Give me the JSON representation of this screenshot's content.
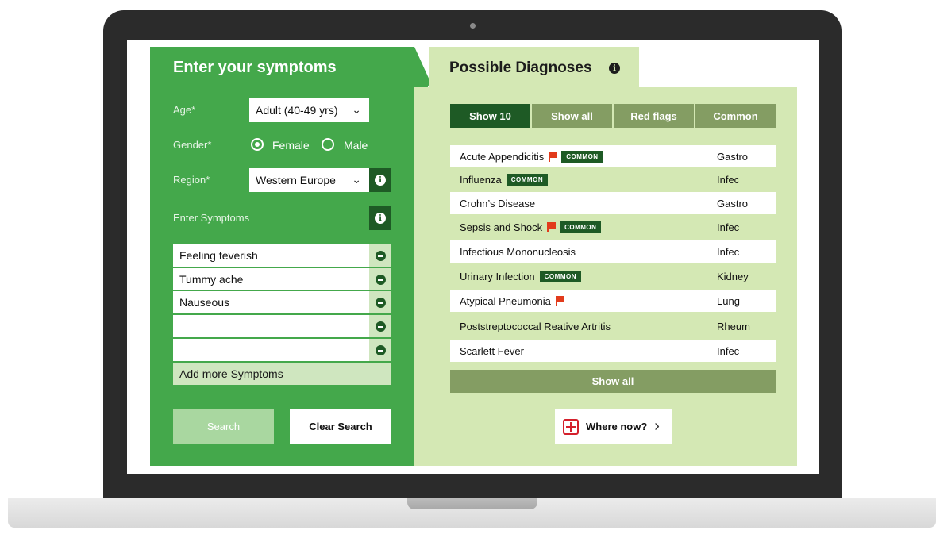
{
  "left_panel": {
    "title": "Enter your symptoms",
    "age_label": "Age*",
    "age_value": "Adult (40-49 yrs)",
    "gender_label": "Gender*",
    "gender_options": [
      "Female",
      "Male"
    ],
    "gender_selected": "Female",
    "region_label": "Region*",
    "region_value": "Western Europe",
    "enter_symptoms_label": "Enter Symptoms",
    "symptoms": [
      "Feeling feverish",
      "Tummy ache",
      "Nauseous",
      "",
      ""
    ],
    "add_more_label": "Add more Symptoms",
    "search_label": "Search",
    "clear_label": "Clear Search"
  },
  "right_panel": {
    "title": "Possible Diagnoses",
    "tabs": [
      "Show 10",
      "Show all",
      "Red flags",
      "Common"
    ],
    "active_tab": "Show 10",
    "common_badge": "COMMON",
    "diagnoses": [
      {
        "name": "Acute Appendicitis",
        "flag": true,
        "common": true,
        "category": "Gastro"
      },
      {
        "name": "Influenza",
        "flag": false,
        "common": true,
        "category": "Infec"
      },
      {
        "name": "Crohn’s Disease",
        "flag": false,
        "common": false,
        "category": "Gastro"
      },
      {
        "name": "Sepsis and Shock",
        "flag": true,
        "common": true,
        "category": "Infec"
      },
      {
        "name": "Infectious Mononucleosis",
        "flag": false,
        "common": false,
        "category": "Infec"
      },
      {
        "name": "Urinary Infection",
        "flag": false,
        "common": true,
        "category": "Kidney"
      },
      {
        "name": "Atypical Pneumonia",
        "flag": true,
        "common": false,
        "category": "Lung"
      },
      {
        "name": "Poststreptococcal Reative Artritis",
        "flag": false,
        "common": false,
        "category": "Rheum"
      },
      {
        "name": "Scarlett Fever",
        "flag": false,
        "common": false,
        "category": "Infec"
      }
    ],
    "show_all_label": "Show all",
    "where_now_label": "Where now?"
  },
  "icons": [
    "info-icon",
    "chevron-down-icon",
    "remove-icon",
    "red-flag-icon",
    "medical-cross-icon",
    "chevron-right-icon"
  ],
  "colors": {
    "primary_green": "#44a84b",
    "dark_green": "#1e5a25",
    "light_green": "#d4e8b4",
    "muted_green": "#849d63",
    "flag_red": "#e23b1c"
  }
}
